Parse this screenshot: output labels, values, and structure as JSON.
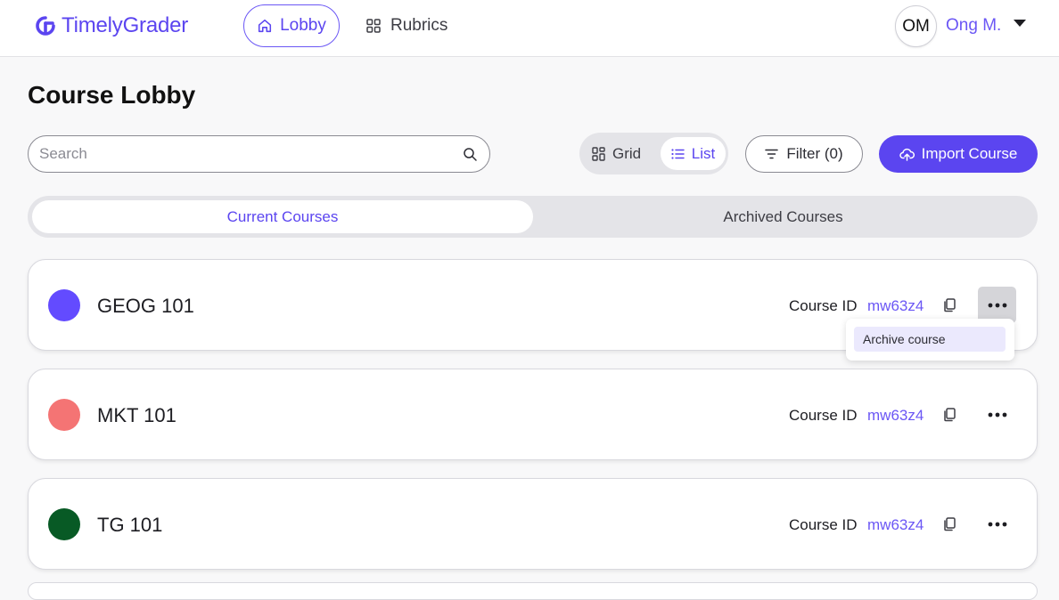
{
  "app": {
    "name": "TimelyGrader"
  },
  "nav": {
    "lobby_label": "Lobby",
    "rubrics_label": "Rubrics"
  },
  "user": {
    "initials": "OM",
    "name": "Ong M."
  },
  "page": {
    "title": "Course Lobby"
  },
  "search": {
    "placeholder": "Search",
    "value": ""
  },
  "view_toggle": {
    "grid_label": "Grid",
    "list_label": "List",
    "selected": "List"
  },
  "filter": {
    "label": "Filter (0)"
  },
  "import": {
    "label": "Import Course"
  },
  "tabs": {
    "current_label": "Current Courses",
    "archived_label": "Archived Courses",
    "selected": "Current Courses"
  },
  "courses": [
    {
      "name": "GEOG 101",
      "color": "#634bff",
      "id_label": "Course ID",
      "id_value": "mw63z4"
    },
    {
      "name": "MKT 101",
      "color": "#f47474",
      "id_label": "Course ID",
      "id_value": "mw63z4"
    },
    {
      "name": "TG 101",
      "color": "#085a25",
      "id_label": "Course ID",
      "id_value": "mw63z4"
    }
  ],
  "dropdown": {
    "archive_label": "Archive course"
  },
  "colors": {
    "accent": "#5b45f0",
    "accent_text": "#6b57f5"
  }
}
